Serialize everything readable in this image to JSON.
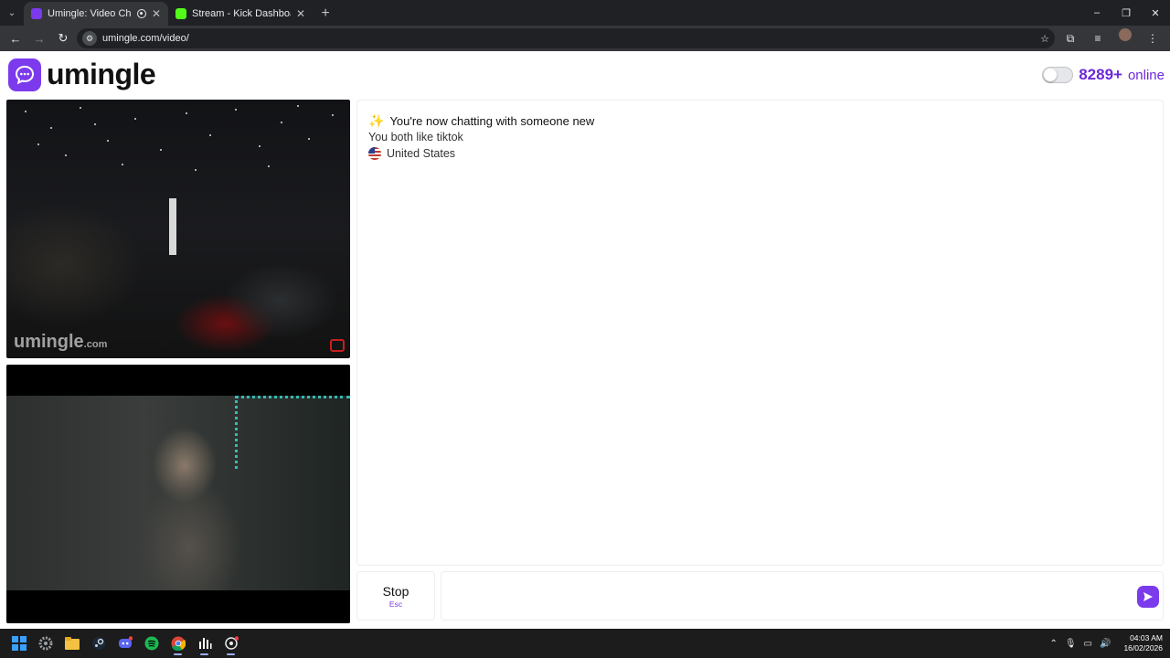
{
  "browser": {
    "tabs": [
      {
        "title": "Umingle: Video Chat with S",
        "favicon_color": "#7c3aed",
        "active": true,
        "recording": true
      },
      {
        "title": "Stream - Kick Dashboard",
        "favicon_color": "#53fc18",
        "active": false,
        "recording": false
      }
    ],
    "new_tab_label": "+",
    "url": "umingle.com/video/",
    "window_controls": [
      "–",
      "❐",
      "✕"
    ]
  },
  "site": {
    "logo_text": "umingle",
    "accent_color": "#7c3aed",
    "online_count": "8289+",
    "online_label": "online"
  },
  "videos": {
    "stranger_watermark": "umingle",
    "stranger_watermark_suffix": ".com"
  },
  "chat": {
    "title": "You're now chatting with someone new",
    "common_interest": "You both like tiktok",
    "country": "United States"
  },
  "controls": {
    "stop_label": "Stop",
    "stop_shortcut": "Esc",
    "message_placeholder": "",
    "send_icon": "send-icon"
  },
  "taskbar": {
    "time": "04:03 AM",
    "date": "16/02/2026",
    "apps": [
      "start",
      "settings",
      "file-explorer",
      "steam",
      "discord",
      "spotify",
      "chrome",
      "audio-app",
      "app"
    ]
  }
}
